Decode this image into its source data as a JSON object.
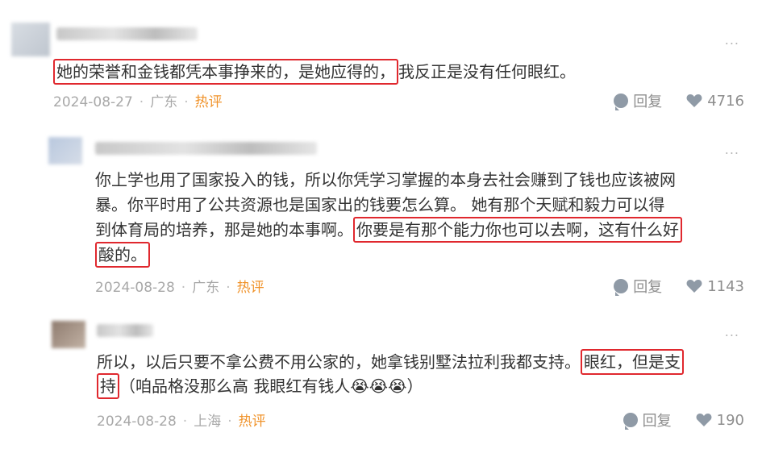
{
  "comments": [
    {
      "text_highlight": "她的荣誉和金钱都凭本事挣来的，是她应得的，",
      "text_rest": "我反正是没有任何眼红。",
      "date": "2024-08-27",
      "location": "广东",
      "tag": "热评",
      "reply_label": "回复",
      "likes": "4716"
    },
    {
      "line1": "你上学也用了国家投入的钱，所以你凭学习掌握的本身去社会赚到了钱也应该被网",
      "line2": "暴。你平时用了公共资源也是国家出的钱要怎么算。 她有那个天赋和毅力可以得",
      "line3_plain": "到体育局的培养，那是她的本事啊。",
      "line3_highlight": "你要是有那个能力你也可以去啊，这有什么好",
      "line4_highlight": "酸的。",
      "date": "2024-08-28",
      "location": "广东",
      "tag": "热评",
      "reply_label": "回复",
      "likes": "1143"
    },
    {
      "line1_plain": "所以，以后只要不拿公费不用公家的，她拿钱别墅法拉利我都支持。",
      "line1_highlight": "眼红，但是支",
      "line2_highlight": "持",
      "line2_rest": "（咱品格没那么高 我眼红有钱人😭😭😭）",
      "date": "2024-08-28",
      "location": "上海",
      "tag": "热评",
      "reply_label": "回复",
      "likes": "190"
    }
  ],
  "ui": {
    "more_glyph": "...",
    "separator": "·",
    "highlight_color": "#e0282e",
    "hot_color": "#f0932b"
  }
}
